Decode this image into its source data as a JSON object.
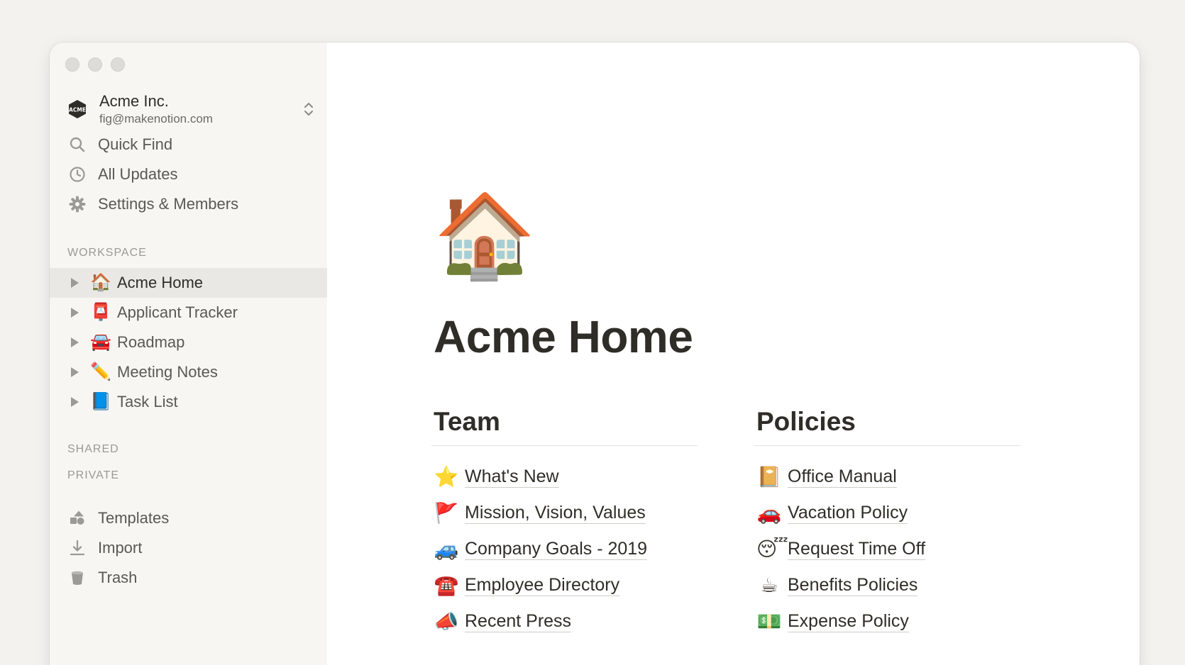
{
  "workspace": {
    "name": "Acme Inc.",
    "email": "fig@makenotion.com",
    "logo_icon": "acme-logo-icon"
  },
  "sidebar": {
    "nav": [
      {
        "label": "Quick Find",
        "icon": "search-icon"
      },
      {
        "label": "All Updates",
        "icon": "clock-icon"
      },
      {
        "label": "Settings & Members",
        "icon": "gear-icon"
      }
    ],
    "sections": {
      "workspace": "WORKSPACE",
      "shared": "SHARED",
      "private": "PRIVATE"
    },
    "pages": [
      {
        "emoji": "🏠",
        "label": "Acme Home",
        "active": true
      },
      {
        "emoji": "📮",
        "label": "Applicant Tracker"
      },
      {
        "emoji": "🚘",
        "label": "Roadmap"
      },
      {
        "emoji": "✏️",
        "label": "Meeting Notes"
      },
      {
        "emoji": "📘",
        "label": "Task List"
      }
    ],
    "footer": [
      {
        "label": "Templates",
        "icon": "templates-icon"
      },
      {
        "label": "Import",
        "icon": "import-icon"
      },
      {
        "label": "Trash",
        "icon": "trash-icon"
      }
    ]
  },
  "page": {
    "icon": "🏠",
    "title": "Acme Home",
    "columns": [
      {
        "heading": "Team",
        "links": [
          {
            "emoji": "⭐",
            "label": "What's New"
          },
          {
            "emoji": "🚩",
            "label": "Mission, Vision, Values"
          },
          {
            "emoji": "🚙",
            "label": "Company Goals - 2019"
          },
          {
            "emoji": "☎️",
            "label": "Employee Directory"
          },
          {
            "emoji": "📣",
            "label": "Recent Press"
          }
        ]
      },
      {
        "heading": "Policies",
        "links": [
          {
            "emoji": "📔",
            "label": "Office Manual"
          },
          {
            "emoji": "🚗",
            "label": "Vacation Policy"
          },
          {
            "emoji": "😴",
            "label": "Request Time Off"
          },
          {
            "emoji": "☕",
            "label": "Benefits Policies"
          },
          {
            "emoji": "💵",
            "label": "Expense Policy"
          }
        ]
      }
    ]
  },
  "colors": {
    "sidebar_bg": "#f7f6f3",
    "active_item_bg": "#e9e8e5",
    "text_primary": "#2f2d28",
    "text_secondary": "#5a5954",
    "text_muted": "#9b9a96"
  }
}
